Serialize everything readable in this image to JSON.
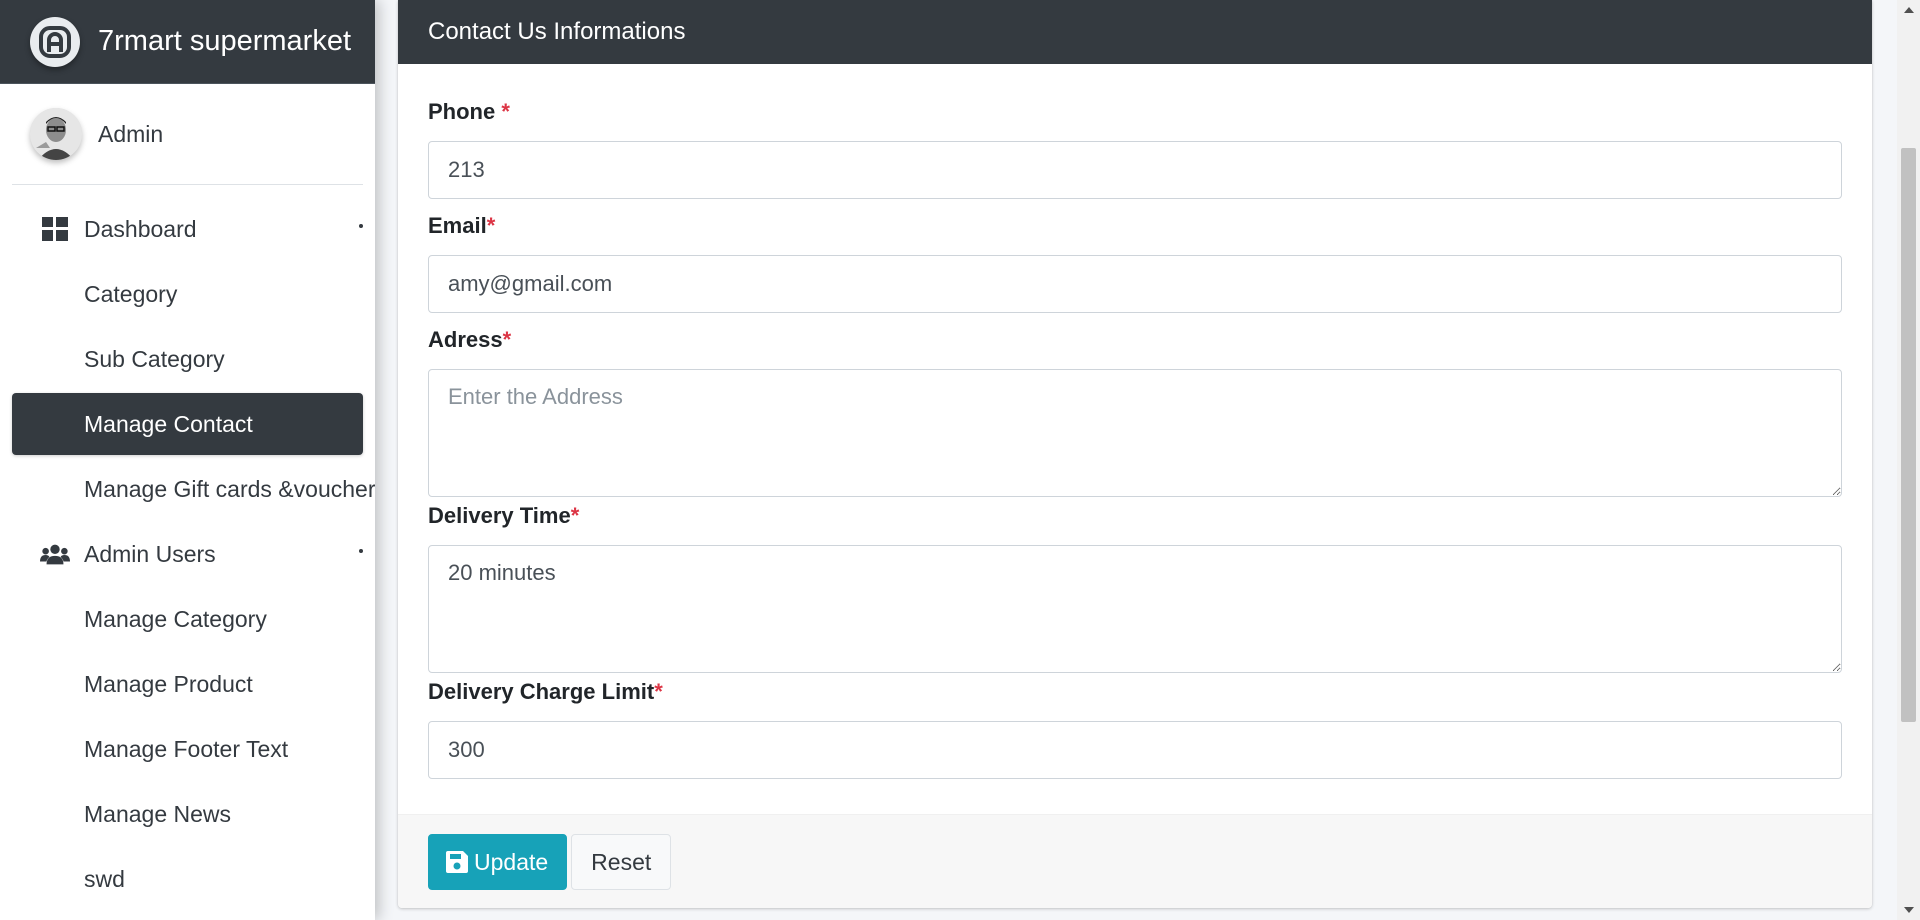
{
  "brand": {
    "name": "7rmart supermarket",
    "logo_icon": "adminlte-logo-icon"
  },
  "user": {
    "name": "Admin"
  },
  "sidebar": {
    "items": [
      {
        "label": "Dashboard",
        "icon": "dashboard-grid-icon",
        "active": false,
        "has_caret": true
      },
      {
        "label": "Category",
        "active": false
      },
      {
        "label": "Sub Category",
        "active": false
      },
      {
        "label": "Manage Contact",
        "active": true
      },
      {
        "label": "Manage Gift cards &voucher",
        "active": false
      },
      {
        "label": "Admin Users",
        "icon": "users-icon",
        "active": false,
        "has_caret": true
      },
      {
        "label": "Manage Category",
        "active": false
      },
      {
        "label": "Manage Product",
        "active": false
      },
      {
        "label": "Manage Footer Text",
        "active": false
      },
      {
        "label": "Manage News",
        "active": false
      },
      {
        "label": "swd",
        "active": false
      }
    ]
  },
  "card": {
    "title": "Contact Us Informations",
    "fields": {
      "phone": {
        "label": "Phone ",
        "required_mark": "*",
        "value": "213"
      },
      "email": {
        "label": "Email",
        "required_mark": "*",
        "value": "amy@gmail.com"
      },
      "address": {
        "label": "Adress",
        "required_mark": "*",
        "value": "",
        "placeholder": "Enter the Address"
      },
      "delivery_time": {
        "label": "Delivery Time",
        "required_mark": "*",
        "value": "20 minutes"
      },
      "delivery_charge_limit": {
        "label": "Delivery Charge Limit",
        "required_mark": "*",
        "value": "300"
      }
    },
    "buttons": {
      "update": "Update",
      "reset": "Reset"
    }
  },
  "colors": {
    "dark": "#343a40",
    "info": "#17a2b8",
    "required": "#dc3545"
  }
}
